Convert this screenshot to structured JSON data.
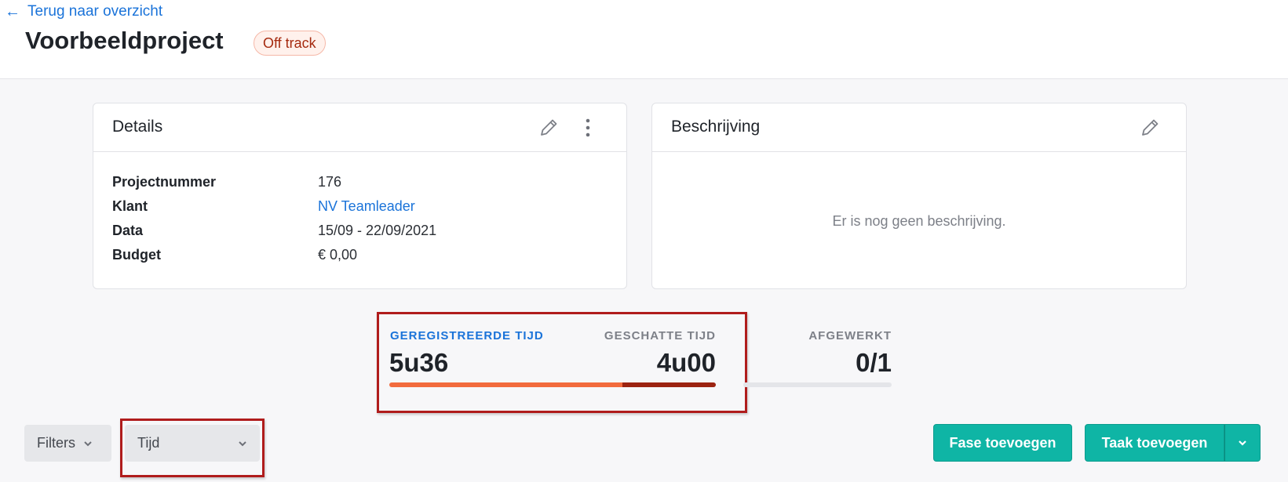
{
  "header": {
    "back_label": "Terug naar overzicht",
    "title": "Voorbeeldproject",
    "status": "Off track"
  },
  "details_card": {
    "title": "Details",
    "rows": [
      {
        "label": "Projectnummer",
        "value": "176"
      },
      {
        "label": "Klant",
        "value": "NV Teamleader"
      },
      {
        "label": "Data",
        "value": "15/09 - 22/09/2021"
      },
      {
        "label": "Budget",
        "value": "€ 0,00"
      }
    ]
  },
  "description_card": {
    "title": "Beschrijving",
    "empty_text": "Er is nog geen beschrijving."
  },
  "stats": {
    "registered": {
      "label": "GEREGISTREERDE TIJD",
      "value": "5u36"
    },
    "estimated": {
      "label": "GESCHATTE TIJD",
      "value": "4u00"
    },
    "completed": {
      "label": "AFGEWERKT",
      "value": "0/1"
    },
    "time_progress_estimated_fraction": 0.714,
    "completed_fraction": 0
  },
  "toolbar": {
    "filters_label": "Filters",
    "group_select_value": "Tijd",
    "add_phase_label": "Fase toevoegen",
    "add_task_label": "Taak toevoegen"
  },
  "colors": {
    "accent_blue": "#1a73d9",
    "teal": "#0fb5a5",
    "progress_orange": "#f26b3d",
    "progress_dark": "#9c2311",
    "highlight_red": "#b01c1c"
  },
  "icons": {
    "back": "arrow-left-icon",
    "edit": "pencil-icon",
    "more": "kebab-icon",
    "chevron": "chevron-down-icon"
  }
}
